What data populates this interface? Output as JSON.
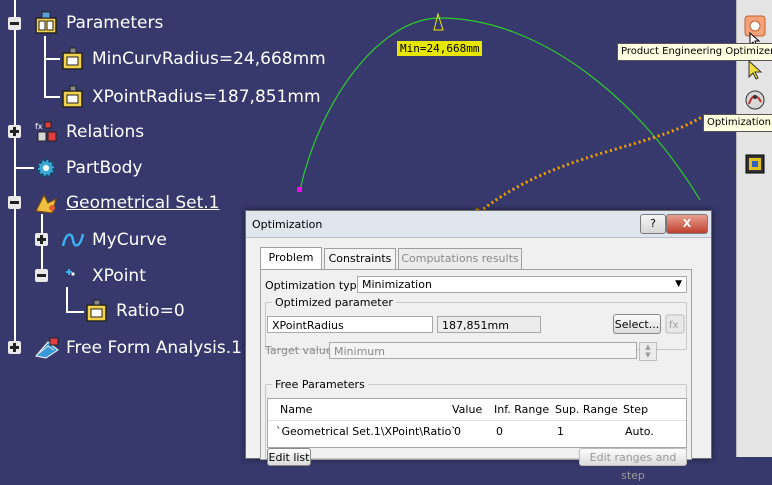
{
  "tree": {
    "items": [
      {
        "label": "Parameters"
      },
      {
        "label": "MinCurvRadius=24,668mm"
      },
      {
        "label": "XPointRadius=187,851mm"
      },
      {
        "label": "Relations"
      },
      {
        "label": "PartBody"
      },
      {
        "label": "Geometrical Set.1"
      },
      {
        "label": "MyCurve"
      },
      {
        "label": "XPoint"
      },
      {
        "label": "Ratio=0"
      },
      {
        "label": "Free Form Analysis.1"
      }
    ]
  },
  "canvas": {
    "curve_label": "Min=24,668mm",
    "curve_color": "#2ecc2e",
    "arrow_color": "#f0a000"
  },
  "tooltips": {
    "product_engineering": "Product Engineering Optimizer",
    "optimization": "Optimization"
  },
  "dialog": {
    "title": "Optimization",
    "help_label": "?",
    "close_label": "X",
    "tabs": [
      {
        "label": "Problem"
      },
      {
        "label": "Constraints"
      },
      {
        "label": "Computations results"
      }
    ],
    "optimization_type_label": "Optimization type:",
    "optimization_type_value": "Minimization",
    "optimized_parameter_label": "Optimized parameter",
    "optimized_parameter_name": "XPointRadius",
    "optimized_parameter_value": "187,851mm",
    "select_label": "Select...",
    "target_value_label": "Target value:",
    "target_value": "Minimum",
    "free_parameters_label": "Free Parameters",
    "table": {
      "headers": [
        "Name",
        "Value",
        "Inf. Range",
        "Sup. Range",
        "Step"
      ],
      "row": [
        "`Geometrical Set.1\\XPoint\\Ratio`",
        "0",
        "0",
        "1",
        "Auto."
      ]
    },
    "edit_list_label": "Edit list",
    "edit_ranges_label": "Edit ranges and step"
  }
}
